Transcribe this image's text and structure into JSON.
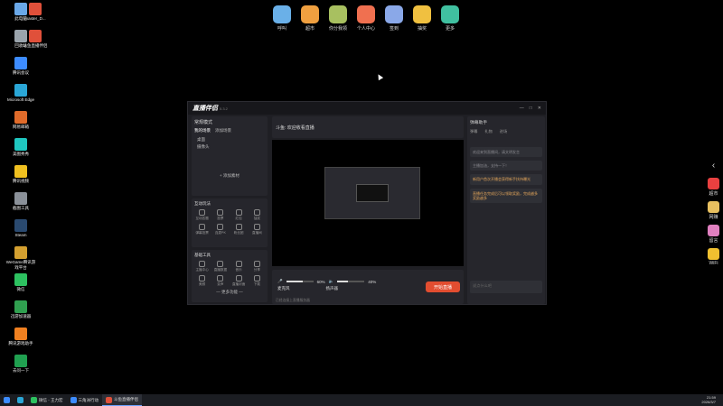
{
  "desktop_icons": [
    {
      "label": "此电脑",
      "color": "#6aa8e8"
    },
    {
      "label": "master_D...",
      "color": "#e0503a"
    },
    {
      "label": "回收站",
      "color": "#9aa4ac"
    },
    {
      "label": "斗鱼直播伴侣",
      "color": "#e0503a"
    },
    {
      "label": "腾讯会议",
      "color": "#3d8cff"
    },
    {
      "label": "Microsoft Edge",
      "color": "#2aa6d6"
    },
    {
      "label": "网易邮箱",
      "color": "#e06b2a"
    },
    {
      "label": "美图秀秀",
      "color": "#1fc7c0"
    },
    {
      "label": "腾讯视频",
      "color": "#f0c020"
    },
    {
      "label": "截图工具",
      "color": "#8a9098"
    },
    {
      "label": "Steam",
      "color": "#2a4a70"
    },
    {
      "label": "WeGame腾讯游戏平台",
      "color": "#d4a030"
    },
    {
      "label": "微信",
      "color": "#2dc160"
    },
    {
      "label": "迅游加速器",
      "color": "#30a050"
    },
    {
      "label": "腾讯游戏助手",
      "color": "#f08020"
    },
    {
      "label": "去问一下",
      "color": "#20a050"
    }
  ],
  "top_dock": [
    {
      "label": "呼叫",
      "color": "#6ab0e8"
    },
    {
      "label": "超市",
      "color": "#f0a040"
    },
    {
      "label": "你分我领",
      "color": "#a8c060"
    },
    {
      "label": "个人中心",
      "color": "#f07050"
    },
    {
      "label": "签到",
      "color": "#8aa8e8"
    },
    {
      "label": "抽奖",
      "color": "#f0c040"
    },
    {
      "label": "更多",
      "color": "#40c0a0"
    }
  ],
  "right_dock": [
    {
      "label": "超市",
      "color": "#e84040"
    },
    {
      "label": "网赚",
      "color": "#e8c060"
    },
    {
      "label": "留言",
      "color": "#e080c0"
    },
    {
      "label": "WiFi",
      "color": "#f0c030"
    }
  ],
  "app": {
    "title": "直播伴侣",
    "version": "5.3.2",
    "stream_title": "斗鱼: 欢迎收看直播",
    "left": {
      "mode": "常规模式",
      "tabs": [
        "我的场景",
        "添加场景"
      ],
      "scenes": [
        "桌面",
        "摄像头"
      ],
      "add_source": "+ 添加素材",
      "interactive_title": "互动玩法",
      "interactive": [
        "互动答题",
        "投票",
        "红包",
        "抽奖",
        "弹幕投票",
        "连麦PK",
        "粉丝团",
        "直播间"
      ],
      "tools_title": "基础工具",
      "tools": [
        "主播中心",
        "直播数据",
        "音乐",
        "分享",
        "美颜",
        "变声",
        "直播封面",
        "下载"
      ],
      "more": "— 更多功能 —"
    },
    "controls": {
      "mic_label": "麦克风",
      "mic_value": "60%",
      "speaker_label": "扬声器",
      "speaker_value": "40%",
      "golive": "开始直播",
      "status": "已经连接上直播服务器"
    },
    "chat": {
      "title": "弹幕助手",
      "tabs": [
        "弹幕",
        "礼物",
        "进场"
      ],
      "messages": [
        {
          "text": "欢迎来到直播间，请文明发言",
          "hl": false
        },
        {
          "text": "主播加油，支持一下！",
          "hl": false
        },
        {
          "text": "新用户首次开播会获得新手扶持曝光",
          "hl": true
        },
        {
          "text": "直播任务完成后可以领取奖励，完成越多奖励越多",
          "hl": true
        }
      ],
      "input": "说点什么吧"
    }
  },
  "taskbar": {
    "items": [
      "微信 - 王力宏",
      "三角洲行动",
      "斗鱼直播伴侣"
    ],
    "time": "21:59",
    "date": "2026/3/7"
  }
}
